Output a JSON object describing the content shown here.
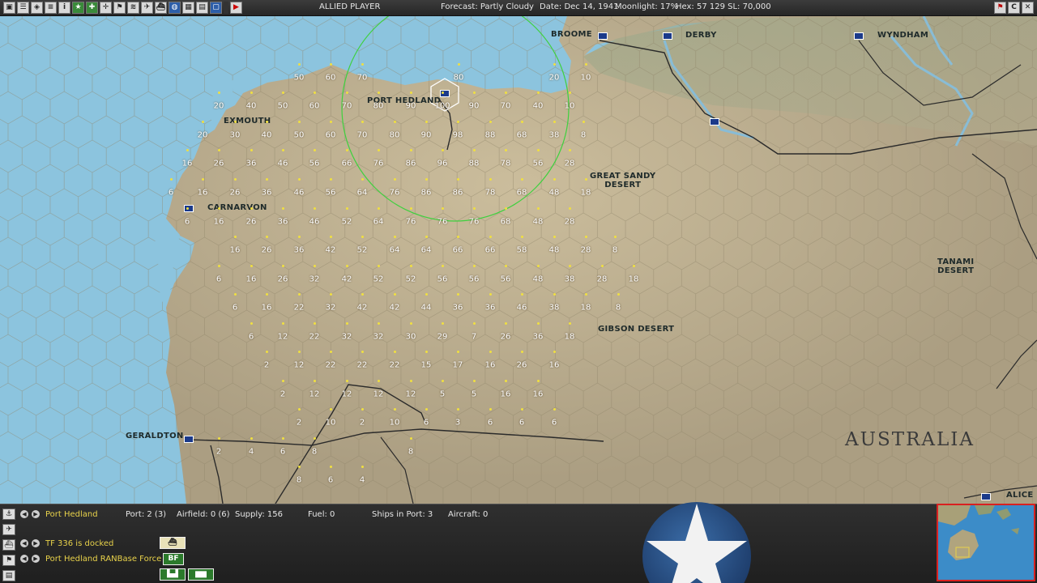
{
  "topbar": {
    "player": "ALLIED PLAYER",
    "forecast": "Forecast: Partly Cloudy",
    "date": "Date: Dec 14, 1941",
    "moonlight": "Moonlight: 17%",
    "hex": "Hex: 57  129  SL: 70,000",
    "left_icons": [
      "save-icon",
      "report-icon",
      "intel-icon",
      "list-icon",
      "info-icon",
      "combat-icon",
      "medical-icon",
      "target-icon",
      "flag-icon",
      "stack-icon",
      "plane-icon",
      "ship-icon",
      "globe-icon",
      "grid-icon",
      "reports-icon",
      "turn-icon"
    ],
    "right_icons": [
      "exit-icon",
      "camera-icon",
      "close-icon"
    ]
  },
  "map": {
    "places": [
      {
        "name": "BROOME"
      },
      {
        "name": "DERBY"
      },
      {
        "name": "WYNDHAM"
      },
      {
        "name": "PORT HEDLAND"
      },
      {
        "name": "EXMOUTH"
      },
      {
        "name": "CARNARVON"
      },
      {
        "name": "GERALDTON"
      },
      {
        "name": "ALICE S"
      }
    ],
    "regions": [
      {
        "name": "GREAT SANDY\nDESERT"
      },
      {
        "name": "TANAMI\nDESERT"
      },
      {
        "name": "GIBSON DESERT"
      }
    ],
    "country_name": "AUSTRALIA",
    "range_numbers": [
      {
        "v": "50"
      },
      {
        "v": "60"
      },
      {
        "v": "70"
      },
      {
        "v": "80"
      },
      {
        "v": "20"
      },
      {
        "v": "10"
      },
      {
        "v": "20"
      },
      {
        "v": "40"
      },
      {
        "v": "50"
      },
      {
        "v": "60"
      },
      {
        "v": "70"
      },
      {
        "v": "80"
      },
      {
        "v": "90"
      },
      {
        "v": "100"
      },
      {
        "v": "90"
      },
      {
        "v": "70"
      },
      {
        "v": "40"
      },
      {
        "v": "10"
      },
      {
        "v": "20"
      },
      {
        "v": "30"
      },
      {
        "v": "40"
      },
      {
        "v": "50"
      },
      {
        "v": "60"
      },
      {
        "v": "70"
      },
      {
        "v": "80"
      },
      {
        "v": "90"
      },
      {
        "v": "98"
      },
      {
        "v": "88"
      },
      {
        "v": "68"
      },
      {
        "v": "38"
      },
      {
        "v": "8"
      },
      {
        "v": "16"
      },
      {
        "v": "26"
      },
      {
        "v": "36"
      },
      {
        "v": "46"
      },
      {
        "v": "56"
      },
      {
        "v": "66"
      },
      {
        "v": "76"
      },
      {
        "v": "86"
      },
      {
        "v": "96"
      },
      {
        "v": "88"
      },
      {
        "v": "78"
      },
      {
        "v": "56"
      },
      {
        "v": "28"
      },
      {
        "v": "6"
      },
      {
        "v": "16"
      },
      {
        "v": "26"
      },
      {
        "v": "36"
      },
      {
        "v": "46"
      },
      {
        "v": "56"
      },
      {
        "v": "64"
      },
      {
        "v": "76"
      },
      {
        "v": "86"
      },
      {
        "v": "86"
      },
      {
        "v": "78"
      },
      {
        "v": "68"
      },
      {
        "v": "48"
      },
      {
        "v": "18"
      },
      {
        "v": "6"
      },
      {
        "v": "16"
      },
      {
        "v": "26"
      },
      {
        "v": "36"
      },
      {
        "v": "46"
      },
      {
        "v": "52"
      },
      {
        "v": "64"
      },
      {
        "v": "76"
      },
      {
        "v": "76"
      },
      {
        "v": "76"
      },
      {
        "v": "68"
      },
      {
        "v": "48"
      },
      {
        "v": "28"
      },
      {
        "v": "16"
      },
      {
        "v": "26"
      },
      {
        "v": "36"
      },
      {
        "v": "42"
      },
      {
        "v": "52"
      },
      {
        "v": "64"
      },
      {
        "v": "64"
      },
      {
        "v": "66"
      },
      {
        "v": "66"
      },
      {
        "v": "58"
      },
      {
        "v": "48"
      },
      {
        "v": "28"
      },
      {
        "v": "8"
      },
      {
        "v": "6"
      },
      {
        "v": "16"
      },
      {
        "v": "26"
      },
      {
        "v": "32"
      },
      {
        "v": "42"
      },
      {
        "v": "52"
      },
      {
        "v": "52"
      },
      {
        "v": "56"
      },
      {
        "v": "56"
      },
      {
        "v": "56"
      },
      {
        "v": "48"
      },
      {
        "v": "38"
      },
      {
        "v": "28"
      },
      {
        "v": "18"
      },
      {
        "v": "6"
      },
      {
        "v": "16"
      },
      {
        "v": "22"
      },
      {
        "v": "32"
      },
      {
        "v": "42"
      },
      {
        "v": "42"
      },
      {
        "v": "44"
      },
      {
        "v": "36"
      },
      {
        "v": "36"
      },
      {
        "v": "46"
      },
      {
        "v": "38"
      },
      {
        "v": "18"
      },
      {
        "v": "8"
      },
      {
        "v": "6"
      },
      {
        "v": "12"
      },
      {
        "v": "22"
      },
      {
        "v": "32"
      },
      {
        "v": "32"
      },
      {
        "v": "30"
      },
      {
        "v": "29"
      },
      {
        "v": "7"
      },
      {
        "v": "26"
      },
      {
        "v": "36"
      },
      {
        "v": "18"
      },
      {
        "v": "2"
      },
      {
        "v": "12"
      },
      {
        "v": "22"
      },
      {
        "v": "22"
      },
      {
        "v": "22"
      },
      {
        "v": "15"
      },
      {
        "v": "17"
      },
      {
        "v": "16"
      },
      {
        "v": "26"
      },
      {
        "v": "16"
      },
      {
        "v": "2"
      },
      {
        "v": "12"
      },
      {
        "v": "12"
      },
      {
        "v": "12"
      },
      {
        "v": "12"
      },
      {
        "v": "5"
      },
      {
        "v": "5"
      },
      {
        "v": "16"
      },
      {
        "v": "16"
      },
      {
        "v": "2"
      },
      {
        "v": "10"
      },
      {
        "v": "2"
      },
      {
        "v": "10"
      },
      {
        "v": "6"
      },
      {
        "v": "3"
      },
      {
        "v": "6"
      },
      {
        "v": "6"
      },
      {
        "v": "6"
      },
      {
        "v": "2"
      },
      {
        "v": "4"
      },
      {
        "v": "6"
      },
      {
        "v": "8"
      },
      {
        "v": "8"
      },
      {
        "v": "8"
      },
      {
        "v": "6"
      },
      {
        "v": "4"
      }
    ]
  },
  "bottom": {
    "base_name": "Port Hedland",
    "port": "Port: 2 (3)",
    "airfield": "Airfield: 0 (6)",
    "supply": "Supply: 156",
    "fuel": "Fuel: 0",
    "ships_in_port": "Ships in Port: 3",
    "aircraft": "Aircraft: 0",
    "tf_status": "TF 336 is docked",
    "unit_name": "Port Hedland RANBase Force",
    "unit_badge": "BF"
  },
  "colors": {
    "ocean": "#8cc4de",
    "land": "#b7a98a",
    "range_circle": "#3ed13e",
    "yellow_text": "#e8d24a"
  }
}
